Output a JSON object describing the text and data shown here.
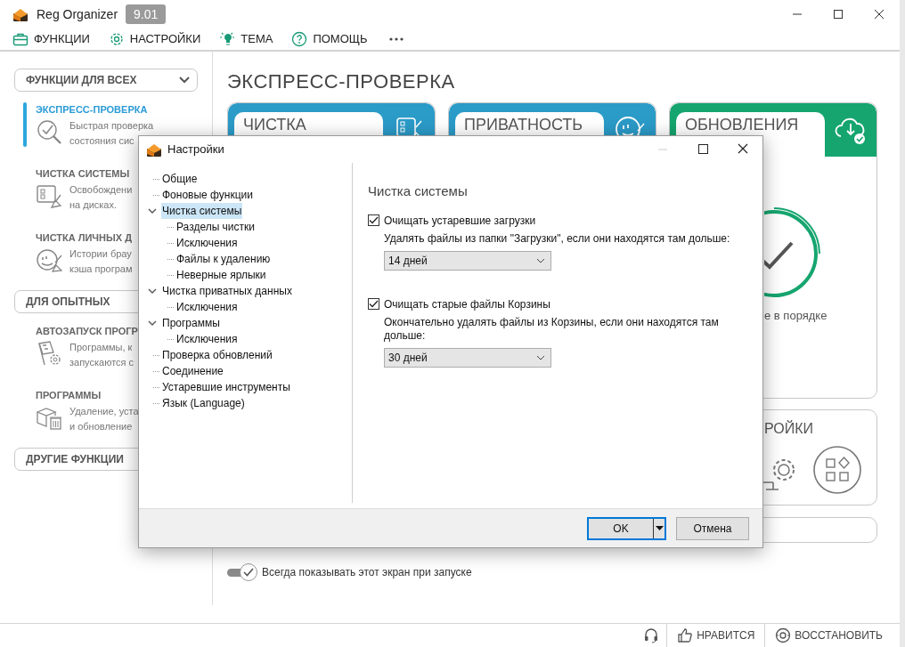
{
  "window": {
    "title": "Reg Organizer",
    "version": "9.01"
  },
  "menu": [
    {
      "label": "ФУНКЦИИ"
    },
    {
      "label": "НАСТРОЙКИ"
    },
    {
      "label": "ТЕМА"
    },
    {
      "label": "ПОМОЩЬ"
    }
  ],
  "sidebar": [
    {
      "kind": "group",
      "label": "ФУНКЦИИ ДЛЯ ВСЕХ",
      "dropdown": true
    },
    {
      "kind": "item",
      "title": "ЭКСПРЕСС-ПРОВЕРКА",
      "lines": [
        "Быстрая проверка",
        "состояния сис"
      ],
      "selected": true
    },
    {
      "kind": "item",
      "title": "ЧИСТКА СИСТЕМЫ",
      "lines": [
        "Освобождени",
        "на дисках."
      ],
      "selected": false
    },
    {
      "kind": "item",
      "title": "ЧИСТКА ЛИЧНЫХ Д",
      "lines": [
        "Истории брау",
        "кэша програм"
      ],
      "selected": false
    },
    {
      "kind": "group",
      "label": "ДЛЯ ОПЫТНЫХ",
      "dropdown": false
    },
    {
      "kind": "item",
      "title": "АВТОЗАПУСК ПРОГР",
      "lines": [
        "Программы, к",
        "запускаются с"
      ],
      "selected": false
    },
    {
      "kind": "item",
      "title": "ПРОГРАММЫ",
      "lines": [
        "Удаление, уста",
        "и обновление"
      ],
      "selected": false
    },
    {
      "kind": "group",
      "label": "ДРУГИЕ ФУНКЦИИ",
      "dropdown": false
    }
  ],
  "main": {
    "heading": "ЭКСПРЕСС-ПРОВЕРКА",
    "cards": [
      {
        "title": "ЧИСТКА",
        "color": "#2b9bc8"
      },
      {
        "title": "ПРИВАТНОСТЬ",
        "color": "#2b9bc8"
      },
      {
        "title": "ОБНОВЛЕНИЯ",
        "color": "#16a56f",
        "status": "е в порядке"
      }
    ],
    "tools_card": {
      "title": "РОЙКИ"
    },
    "startup_toggle": {
      "label": "Всегда показывать этот экран при запуске",
      "on": true
    }
  },
  "status_bar": [
    {
      "label": "НРАВИТСЯ"
    },
    {
      "label": "ВОССТАНОВИТЬ"
    }
  ],
  "dialog": {
    "title": "Настройки",
    "tree": [
      {
        "label": "Общие",
        "selected": false
      },
      {
        "label": "Фоновые функции",
        "selected": false
      },
      {
        "label": "Чистка системы",
        "selected": true,
        "expanded": true,
        "children": [
          {
            "label": "Разделы чистки",
            "selected": false
          },
          {
            "label": "Исключения",
            "selected": false
          },
          {
            "label": "Файлы к удалению",
            "selected": false
          },
          {
            "label": "Неверные ярлыки",
            "selected": false
          }
        ]
      },
      {
        "label": "Чистка приватных данных",
        "selected": false,
        "expanded": true,
        "children": [
          {
            "label": "Исключения",
            "selected": false
          }
        ]
      },
      {
        "label": "Программы",
        "selected": false,
        "expanded": true,
        "children": [
          {
            "label": "Исключения",
            "selected": false
          }
        ]
      },
      {
        "label": "Проверка обновлений",
        "selected": false
      },
      {
        "label": "Соединение",
        "selected": false
      },
      {
        "label": "Устаревшие инструменты",
        "selected": false
      },
      {
        "label": "Язык (Language)",
        "selected": false
      }
    ],
    "section_title": "Чистка системы",
    "options": [
      {
        "label": "Очищать устаревшие загрузки",
        "checked": true,
        "hint": "Удалять файлы из папки \"Загрузки\", если они находятся там дольше:",
        "value": "14 дней"
      },
      {
        "label": "Очищать старые файлы Корзины",
        "checked": true,
        "hint": "Окончательно удалять файлы из Корзины, если они находятся там дольше:",
        "value": "30 дней"
      }
    ],
    "ok_button": "OK",
    "cancel_button": "Отмена"
  }
}
